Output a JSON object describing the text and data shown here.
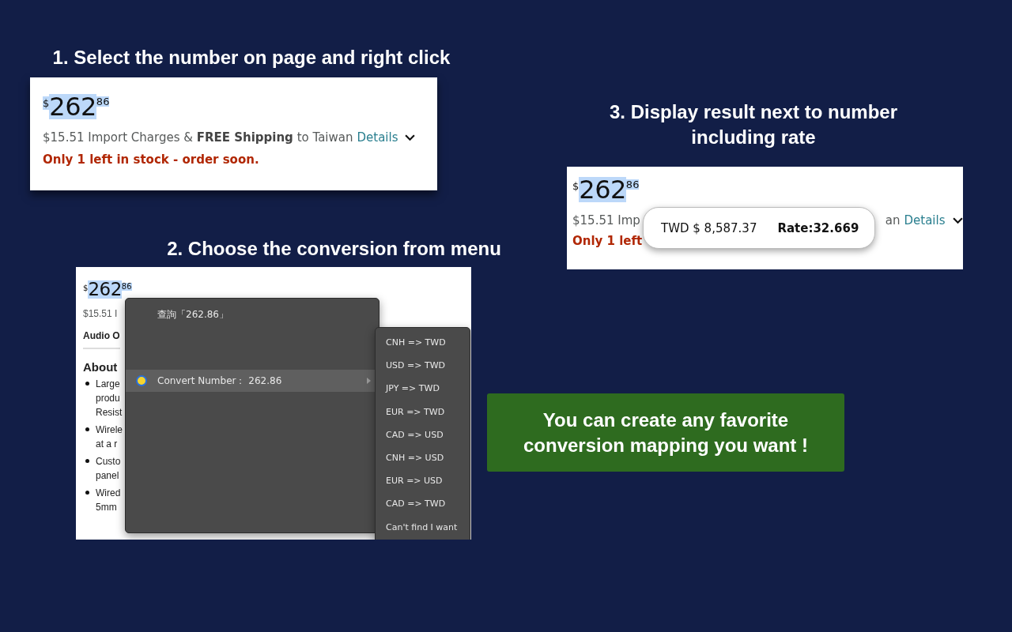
{
  "step1": {
    "title": "1. Select the number on page and right click",
    "price": {
      "currency": "$",
      "whole": "262",
      "fraction": "86",
      "currency_selected": true
    },
    "shipping": "$15.51 Import Charges & **FREE Shipping** to Taiwan",
    "details_link": "Details",
    "stock": "Only 1 left in stock - order soon."
  },
  "step2": {
    "title": "2. Choose the conversion from menu",
    "price": {
      "currency": "$",
      "whole": "262",
      "fraction": "86",
      "currency_selected": false
    },
    "page_lines": [
      {
        "kind": "text",
        "text": "$15.51 I"
      },
      {
        "kind": "bold",
        "text": "Audio O"
      },
      {
        "kind": "heading",
        "text": "About"
      }
    ],
    "bullets": [
      {
        "lines": [
          "Large",
          "produ",
          "Resist"
        ]
      },
      {
        "lines": [
          "Wirele",
          "at a r"
        ]
      },
      {
        "lines": [
          "Custo",
          "panel"
        ]
      },
      {
        "lines": [
          "Wired",
          "5mm"
        ]
      }
    ],
    "menu": [
      {
        "kind": "plain",
        "label": "查詢「262.86」",
        "selected": false
      },
      {
        "kind": "spacer"
      },
      {
        "kind": "submenu",
        "label": "Convert Number：  262.86",
        "selected": true
      }
    ],
    "submenu": [
      "CNH => TWD",
      "USD => TWD",
      "JPY => TWD",
      "EUR => TWD",
      "CAD => USD",
      "CNH => USD",
      "EUR => USD",
      "CAD => TWD",
      "Can't find I want"
    ]
  },
  "step3": {
    "title": "3. Display result next to number including rate",
    "price": {
      "currency": "$",
      "whole": "262",
      "fraction": "86",
      "currency_selected": false
    },
    "shipping_start": "$15.51 Imp",
    "shipping_end": "an",
    "details_link": "Details",
    "stock": "Only 1 left",
    "result": {
      "amount": "TWD $ 8,587.37",
      "rate": "Rate:32.669"
    }
  },
  "callout": "You can create any favorite conversion mapping you want !"
}
